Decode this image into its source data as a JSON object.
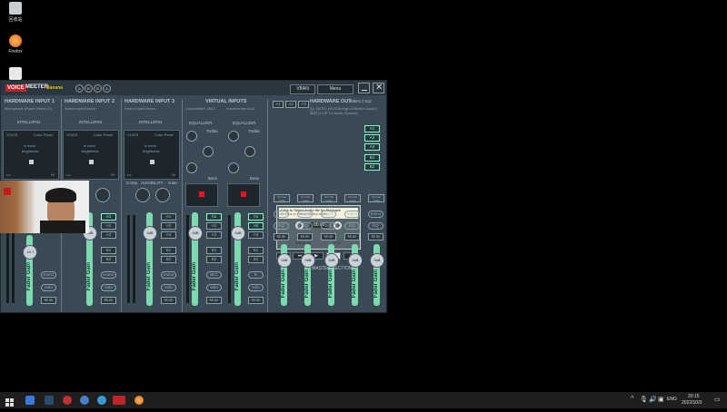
{
  "desktop": {
    "icons": [
      {
        "label": "回收站",
        "icon": "recycle-bin-icon"
      },
      {
        "label": "Firefox",
        "icon": "firefox-icon"
      },
      {
        "label": "",
        "icon": "app-icon"
      }
    ]
  },
  "window": {
    "logo_voice": "VOICE",
    "logo_meeter": "MEETER",
    "logo_banana": "Banana",
    "vban": "VBAN",
    "menu": "Menu",
    "letters": [
      "A",
      "B",
      "R",
      "A"
    ]
  },
  "strips": [
    {
      "title": "HARDWARE INPUT 1",
      "device": "Microphone (Razer Seiren X)",
      "intelli": "INTELLIPAN",
      "voice": "VOICE",
      "color": "Color Panel",
      "fx": "fx echo",
      "bright": "brightness",
      "lo": "Lo",
      "hi": "Hi",
      "aud": "AUDIBILITY",
      "gain": "-10.7",
      "fader": "Fader Gain",
      "mono": "mono",
      "solo": "solo",
      "mute": "Mute"
    },
    {
      "title": "HARDWARE INPUT 2",
      "device": "Select Input Device",
      "intelli": "INTELLIPAN",
      "voice": "VOICE",
      "color": "Color Panel",
      "fx": "fx echo",
      "bright": "brightness",
      "lo": "Lo",
      "hi": "Hi",
      "aud": "AUDIBILITY",
      "gain": "0dB",
      "fader": "Fader Gain",
      "mono": "mono",
      "solo": "solo",
      "mute": "Mute"
    },
    {
      "title": "HARDWARE INPUT 3",
      "device": "Select Input Device",
      "intelli": "INTELLIPAN",
      "voice": "VOICE",
      "color": "Color Panel",
      "fx": "fx echo",
      "bright": "brightness",
      "lo": "Lo",
      "hi": "Hi",
      "aud": "AUDIBILITY",
      "comp": "Comp.",
      "gate": "Gate",
      "gain": "0dB",
      "fader": "Fader Gain",
      "mono": "mono",
      "solo": "solo",
      "mute": "Mute"
    }
  ],
  "virtual": {
    "title": "VIRTUAL INPUTS",
    "v1": "Voicemeeter VAIO",
    "v2": "Voicemeeter AUX",
    "eq1": "EQUALIZER",
    "eq2": "EQUALIZER",
    "treble": "Treble",
    "bass": "Bass",
    "gain1": "0dB",
    "gain2": "0dB",
    "fader": "Fader Gain",
    "mc": "M.C",
    "k": "K",
    "solo": "solo",
    "mute": "Mute"
  },
  "hwout": {
    "title": "HARDWARE OUT",
    "rate": "48kHz | 512",
    "dev1": "A1: DCEO (NVIDIA High Definition Audio)",
    "dev2": "耳机 (2-HE V1 Audio System)",
    "player_line1": "Click to Select Audio file for Playback",
    "player_line2": "Or Click on Record Button below",
    "time": "00:00",
    "freq": "48000 Hz",
    "ch": "2 Ch",
    "buses": [
      "A1",
      "A2",
      "A3",
      "B1",
      "B2"
    ]
  },
  "master": {
    "title": "MASTER SECTION",
    "normal": "Normal mode",
    "mono": "mono",
    "eq": "EQ",
    "mute": "Mute",
    "gain": "0dB",
    "fader": "Fader Gain"
  },
  "bus_labels": [
    "A1",
    "A2",
    "A3",
    "B1",
    "B2"
  ],
  "taskbar": {
    "lang": "ENG",
    "time": "20:15",
    "date": "2022/10/3"
  }
}
